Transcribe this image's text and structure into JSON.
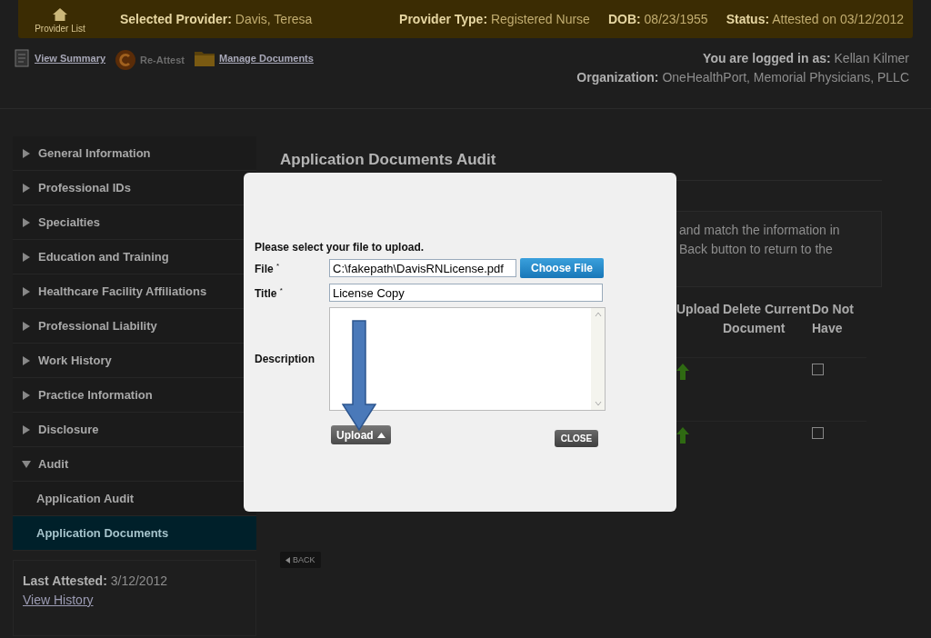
{
  "header": {
    "home_label": "Provider List",
    "provider": {
      "label": "Selected Provider:",
      "value": "Davis, Teresa"
    },
    "details": [
      {
        "label": "Provider Type:",
        "value": "Registered Nurse"
      },
      {
        "label": "DOB:",
        "value": "08/23/1955"
      },
      {
        "label": "Status:",
        "value": "Attested on 03/12/2012"
      }
    ]
  },
  "toolbar": [
    {
      "kind": "summary",
      "label": "View Summary",
      "disabled": false
    },
    {
      "kind": "reattest",
      "label": "Re-Attest",
      "disabled": true
    },
    {
      "kind": "documents",
      "label": "Manage Documents",
      "disabled": false
    }
  ],
  "user": {
    "login_label": "You are logged in as:",
    "login_value": "Kellan Kilmer",
    "org_label": "Organization:",
    "org_value": "OneHealthPort, Memorial Physicians, PLLC"
  },
  "sidebar": {
    "items": [
      {
        "label": "General Information",
        "expanded": false
      },
      {
        "label": "Professional IDs",
        "expanded": false
      },
      {
        "label": "Specialties",
        "expanded": false
      },
      {
        "label": "Education and Training",
        "expanded": false
      },
      {
        "label": "Healthcare Facility Affiliations",
        "expanded": false
      },
      {
        "label": "Professional Liability",
        "expanded": false
      },
      {
        "label": "Work History",
        "expanded": false
      },
      {
        "label": "Practice Information",
        "expanded": false
      },
      {
        "label": "Disclosure",
        "expanded": false
      },
      {
        "label": "Audit",
        "expanded": true,
        "children": [
          {
            "label": "Application Audit",
            "selected": false
          },
          {
            "label": "Application Documents",
            "selected": true
          }
        ]
      }
    ],
    "last_attested_label": "Last Attested:",
    "last_attested_value": "3/12/2012",
    "history_link": "View History"
  },
  "main": {
    "title": "Application Documents Audit",
    "notice_lines": [
      "and match the information in",
      "Back button to return to the"
    ],
    "columns": [
      "Upload",
      "Delete Current Document",
      "Do Not Have"
    ],
    "rows": [
      {
        "do_not_have": false
      },
      {
        "do_not_have": false
      }
    ],
    "back_button": "BACK"
  },
  "dialog": {
    "prompt": "Please select your file to upload.",
    "file_label": "File",
    "file_value": "C:\\fakepath\\DavisRNLicense.pdf",
    "choose_button": "Choose File",
    "title_label": "Title",
    "title_value": "License Copy",
    "required_mark": "*",
    "description_label": "Description",
    "upload_button": "Upload",
    "close_button": "CLOSE"
  }
}
